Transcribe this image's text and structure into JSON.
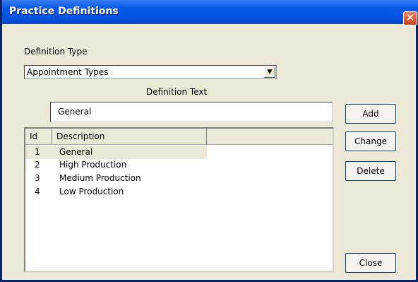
{
  "window": {
    "title": "Practice Definitions",
    "close_glyph": "✕"
  },
  "definition_type": {
    "label": "Definition Type",
    "selected": "Appointment Types",
    "arrow_glyph": "▼"
  },
  "definition_text": {
    "label": "Definition Text",
    "value": "General"
  },
  "buttons": {
    "add": "Add",
    "change": "Change",
    "delete": "Delete",
    "close": "Close"
  },
  "list": {
    "columns": [
      "Id",
      "Description"
    ],
    "rows": [
      {
        "id": "1",
        "description": "General",
        "selected": true
      },
      {
        "id": "2",
        "description": "High Production",
        "selected": false
      },
      {
        "id": "3",
        "description": "Medium Production",
        "selected": false
      },
      {
        "id": "4",
        "description": "Low Production",
        "selected": false
      }
    ]
  }
}
